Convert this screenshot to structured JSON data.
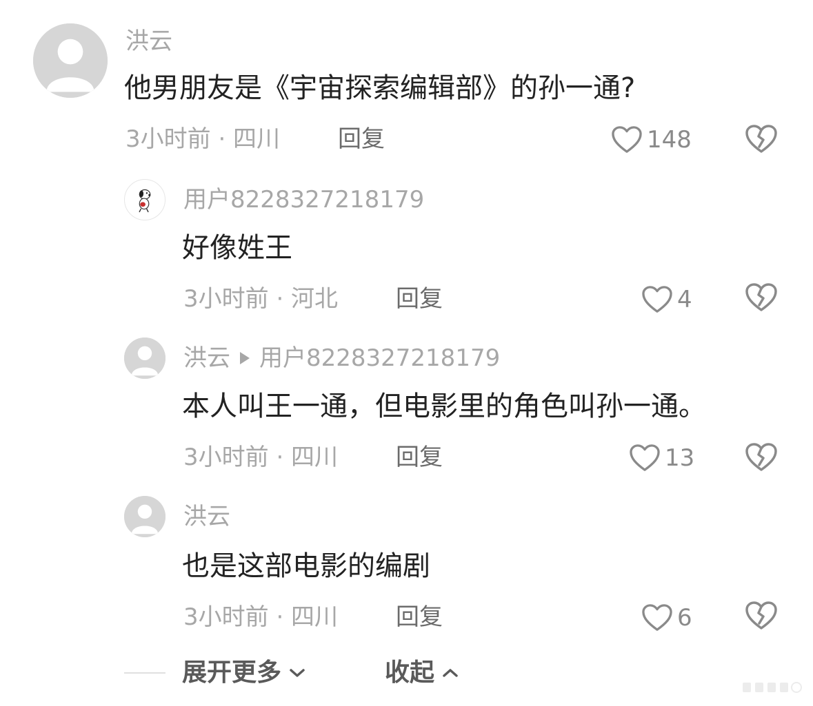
{
  "comments": [
    {
      "username": "洪云",
      "text": "他男朋友是《宇宙探索编辑部》的孙一通?",
      "meta": "3小时前 · 四川",
      "reply_label": "回复",
      "likes": "148"
    },
    {
      "username": "用户8228327218179",
      "text": "好像姓王",
      "meta": "3小时前 · 河北",
      "reply_label": "回复",
      "likes": "4"
    },
    {
      "username": "洪云",
      "reply_to": "用户8228327218179",
      "text": "本人叫王一通，但电影里的角色叫孙一通。",
      "meta": "3小时前 · 四川",
      "reply_label": "回复",
      "likes": "13"
    },
    {
      "username": "洪云",
      "text": "也是这部电影的编剧",
      "meta": "3小时前 · 四川",
      "reply_label": "回复",
      "likes": "6"
    }
  ],
  "footer": {
    "expand_label": "展开更多",
    "collapse_label": "收起"
  },
  "icons": {
    "like": "heart-outline-icon",
    "dislike": "broken-heart-icon",
    "expand": "chevron-down-icon",
    "collapse": "chevron-up-icon"
  },
  "colors": {
    "username": "#a7a7a7",
    "text": "#222222",
    "reply": "#6b6b6b",
    "icon": "#8a8a8a"
  }
}
